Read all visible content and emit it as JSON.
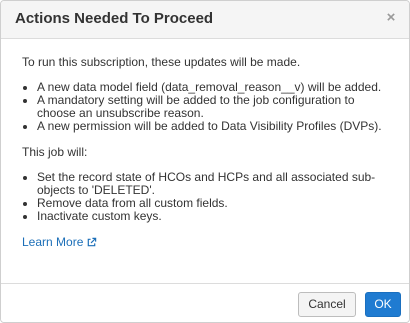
{
  "dialog": {
    "title": "Actions Needed To Proceed",
    "close_symbol": "×",
    "intro": "To run this subscription, these updates will be made.",
    "updates": [
      "A new data model field (data_removal_reason__v) will be added.",
      "A mandatory setting will be added to the job configuration to choose an unsubscribe reason.",
      "A new permission will be added to Data Visibility Profiles (DVPs)."
    ],
    "job_will_label": "This job will:",
    "job_actions": [
      "Set the record state of HCOs and HCPs and all associated sub-objects to 'DELETED'.",
      "Remove data from all custom fields.",
      "Inactivate custom keys."
    ],
    "learn_more_label": "Learn More",
    "learn_more_icon": "external-link-icon",
    "cancel_label": "Cancel",
    "ok_label": "OK"
  },
  "colors": {
    "header_bg": "#f5f5f5",
    "link": "#1c6fb8",
    "primary_button": "#1f7bd1",
    "text": "#333333"
  }
}
